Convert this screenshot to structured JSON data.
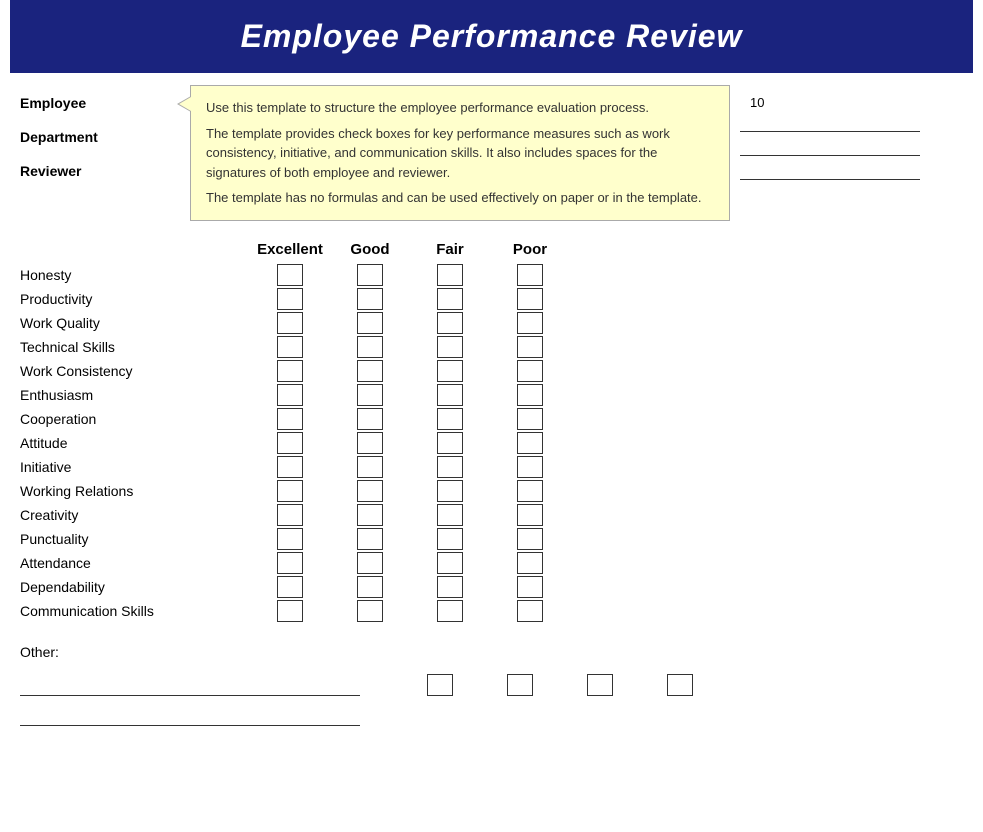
{
  "header": {
    "title": "Employee Performance Review"
  },
  "tooltip": {
    "text1": "Use this template to structure the employee performance evaluation process.",
    "text2": "The template provides check boxes for key performance measures such as work consistency, initiative, and communication skills. It also includes spaces for the signatures of both employee and reviewer.",
    "text3": "The template has no formulas and can be used effectively on paper or in the template."
  },
  "info_fields": {
    "employee_label": "Employee",
    "department_label": "Department",
    "reviewer_label": "Reviewer"
  },
  "page_number": "10",
  "rating_headers": [
    "Excellent",
    "Good",
    "Fair",
    "Poor"
  ],
  "performance_items": [
    "Honesty",
    "Productivity",
    "Work Quality",
    "Technical Skills",
    "Work Consistency",
    "Enthusiasm",
    "Cooperation",
    "Attitude",
    "Initiative",
    "Working Relations",
    "Creativity",
    "Punctuality",
    "Attendance",
    "Dependability",
    "Communication Skills"
  ],
  "other_label": "Other:"
}
